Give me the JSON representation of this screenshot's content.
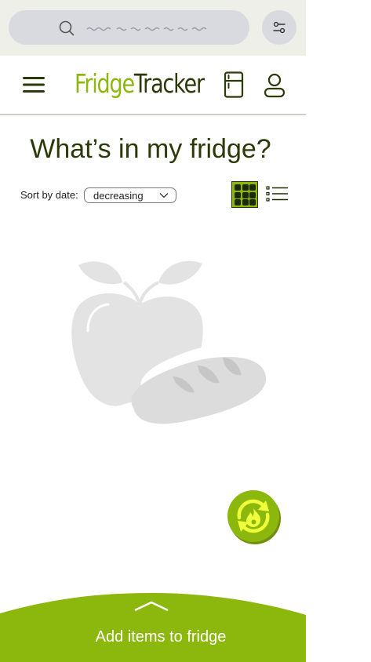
{
  "app": {
    "brand_part1": "Fridge",
    "brand_part2": "Tracker"
  },
  "search": {
    "placeholder_scribble": "placeholder text (illegible)"
  },
  "main": {
    "title": "What’s in my fridge?",
    "sort_label": "Sort by date:",
    "sort_value": "decreasing"
  },
  "bottom_sheet": {
    "label": "Add items to fridge"
  },
  "colors": {
    "accent": "#8cb80e",
    "dark": "#2b3a08",
    "search_bg": "#efefe9",
    "pill_bg": "#d9d9e0",
    "illustration": "#e3e3e3"
  },
  "icons": {
    "search": "search-icon",
    "filter": "sliders-icon",
    "menu": "hamburger-icon",
    "fridge": "fridge-icon",
    "account": "user-icon",
    "grid_view": "grid-icon",
    "list_view": "list-icon",
    "refresh": "refresh-flame-icon",
    "handle": "chevron-up-icon",
    "empty": "apple-bread-illustration"
  }
}
